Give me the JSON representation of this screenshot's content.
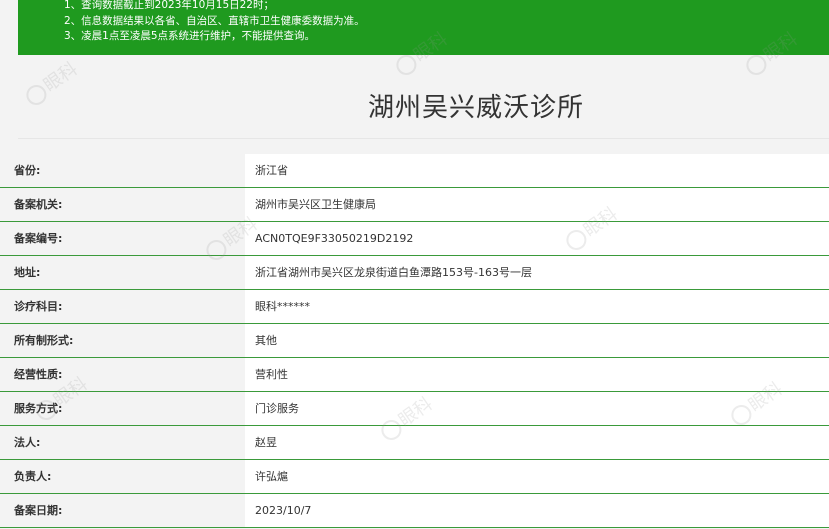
{
  "notice": {
    "lines": [
      "1、查询数据截止到2023年10月15日22时；",
      "2、信息数据结果以各省、自治区、直辖市卫生健康委数据为准。",
      "3、凌晨1点至凌晨5点系统进行维护，不能提供查询。"
    ]
  },
  "page_title": "湖州吴兴威沃诊所",
  "rows": [
    {
      "label": "省份:",
      "value": "浙江省"
    },
    {
      "label": "备案机关:",
      "value": "湖州市吴兴区卫生健康局"
    },
    {
      "label": "备案编号:",
      "value": "ACN0TQE9F33050219D2192"
    },
    {
      "label": "地址:",
      "value": "浙江省湖州市吴兴区龙泉街道白鱼潭路153号-163号一层"
    },
    {
      "label": "诊疗科目:",
      "value": "眼科******"
    },
    {
      "label": "所有制形式:",
      "value": "其他"
    },
    {
      "label": "经营性质:",
      "value": "营利性"
    },
    {
      "label": "服务方式:",
      "value": "门诊服务"
    },
    {
      "label": "法人:",
      "value": "赵昱"
    },
    {
      "label": "负责人:",
      "value": "许弘熩"
    },
    {
      "label": "备案日期:",
      "value": "2023/10/7"
    }
  ],
  "watermark_text": "眼科"
}
